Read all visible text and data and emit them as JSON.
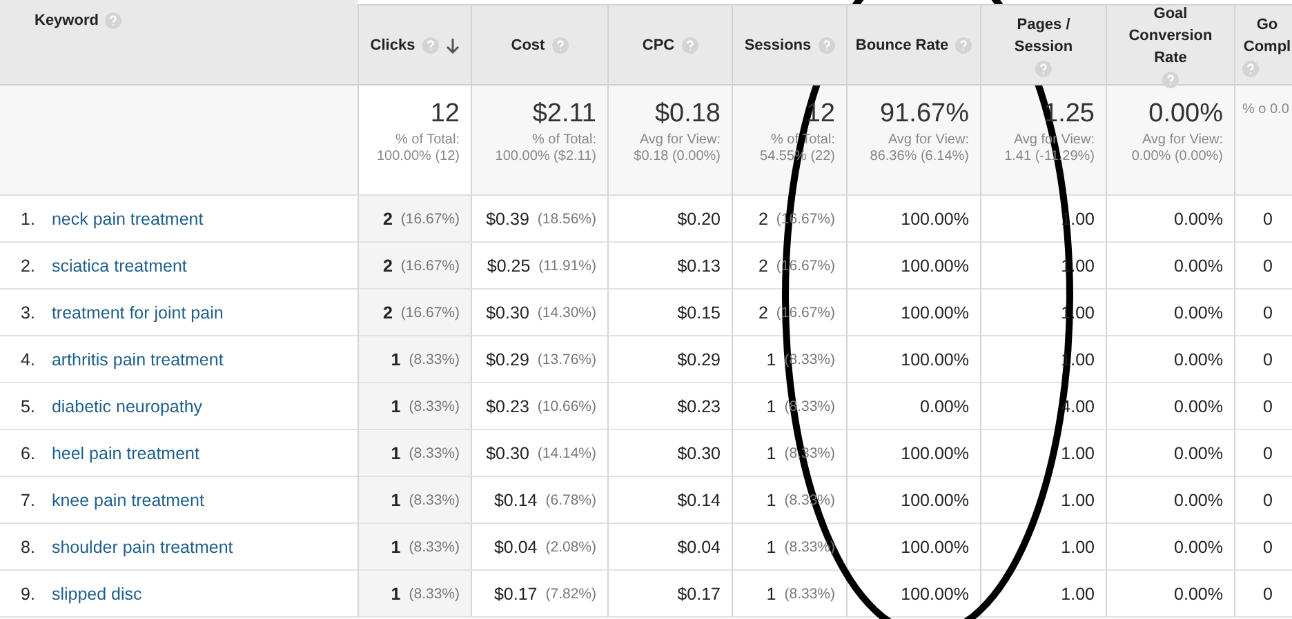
{
  "table": {
    "keyword_header": "Keyword",
    "columns": [
      {
        "label": "Clicks",
        "sorted": true
      },
      {
        "label": "Cost",
        "sorted": false
      },
      {
        "label": "CPC",
        "sorted": false
      },
      {
        "label": "Sessions",
        "sorted": false
      },
      {
        "label": "Bounce Rate",
        "sorted": false
      },
      {
        "label": "Pages / Session",
        "sorted": false
      },
      {
        "label": "Goal Conversion Rate",
        "sorted": false
      },
      {
        "label": "Go Compl",
        "sorted": false
      }
    ],
    "summary": [
      {
        "value": "12",
        "note": "% of Total: 100.00% (12)"
      },
      {
        "value": "$2.11",
        "note": "% of Total: 100.00% ($2.11)"
      },
      {
        "value": "$0.18",
        "note": "Avg for View: $0.18 (0.00%)"
      },
      {
        "value": "12",
        "note": "% of Total: 54.55% (22)"
      },
      {
        "value": "91.67%",
        "note": "Avg for View: 86.36% (6.14%)"
      },
      {
        "value": "1.25",
        "note": "Avg for View: 1.41 (-11.29%)"
      },
      {
        "value": "0.00%",
        "note": "Avg for View: 0.00% (0.00%)"
      },
      {
        "note": "% o 0.0"
      }
    ],
    "rows": [
      {
        "number": "1.",
        "keyword": "neck pain treatment",
        "cells": [
          {
            "value": "2",
            "share": "(16.67%)"
          },
          {
            "value": "$0.39",
            "share": "(18.56%)"
          },
          {
            "value": "$0.20"
          },
          {
            "value": "2",
            "share": "(16.67%)"
          },
          {
            "value": "100.00%"
          },
          {
            "value": "1.00"
          },
          {
            "value": "0.00%"
          },
          {
            "value": "0"
          }
        ]
      },
      {
        "number": "2.",
        "keyword": "sciatica treatment",
        "cells": [
          {
            "value": "2",
            "share": "(16.67%)"
          },
          {
            "value": "$0.25",
            "share": "(11.91%)"
          },
          {
            "value": "$0.13"
          },
          {
            "value": "2",
            "share": "(16.67%)"
          },
          {
            "value": "100.00%"
          },
          {
            "value": "1.00"
          },
          {
            "value": "0.00%"
          },
          {
            "value": "0"
          }
        ]
      },
      {
        "number": "3.",
        "keyword": "treatment for joint pain",
        "cells": [
          {
            "value": "2",
            "share": "(16.67%)"
          },
          {
            "value": "$0.30",
            "share": "(14.30%)"
          },
          {
            "value": "$0.15"
          },
          {
            "value": "2",
            "share": "(16.67%)"
          },
          {
            "value": "100.00%"
          },
          {
            "value": "1.00"
          },
          {
            "value": "0.00%"
          },
          {
            "value": "0"
          }
        ]
      },
      {
        "number": "4.",
        "keyword": "arthritis pain treatment",
        "cells": [
          {
            "value": "1",
            "share": "(8.33%)"
          },
          {
            "value": "$0.29",
            "share": "(13.76%)"
          },
          {
            "value": "$0.29"
          },
          {
            "value": "1",
            "share": "(8.33%)"
          },
          {
            "value": "100.00%"
          },
          {
            "value": "1.00"
          },
          {
            "value": "0.00%"
          },
          {
            "value": "0"
          }
        ]
      },
      {
        "number": "5.",
        "keyword": "diabetic neuropathy",
        "cells": [
          {
            "value": "1",
            "share": "(8.33%)"
          },
          {
            "value": "$0.23",
            "share": "(10.66%)"
          },
          {
            "value": "$0.23"
          },
          {
            "value": "1",
            "share": "(8.33%)"
          },
          {
            "value": "0.00%"
          },
          {
            "value": "4.00"
          },
          {
            "value": "0.00%"
          },
          {
            "value": "0"
          }
        ]
      },
      {
        "number": "6.",
        "keyword": "heel pain treatment",
        "cells": [
          {
            "value": "1",
            "share": "(8.33%)"
          },
          {
            "value": "$0.30",
            "share": "(14.14%)"
          },
          {
            "value": "$0.30"
          },
          {
            "value": "1",
            "share": "(8.33%)"
          },
          {
            "value": "100.00%"
          },
          {
            "value": "1.00"
          },
          {
            "value": "0.00%"
          },
          {
            "value": "0"
          }
        ]
      },
      {
        "number": "7.",
        "keyword": "knee pain treatment",
        "cells": [
          {
            "value": "1",
            "share": "(8.33%)"
          },
          {
            "value": "$0.14",
            "share": "(6.78%)"
          },
          {
            "value": "$0.14"
          },
          {
            "value": "1",
            "share": "(8.33%)"
          },
          {
            "value": "100.00%"
          },
          {
            "value": "1.00"
          },
          {
            "value": "0.00%"
          },
          {
            "value": "0"
          }
        ]
      },
      {
        "number": "8.",
        "keyword": "shoulder pain treatment",
        "cells": [
          {
            "value": "1",
            "share": "(8.33%)"
          },
          {
            "value": "$0.04",
            "share": "(2.08%)"
          },
          {
            "value": "$0.04"
          },
          {
            "value": "1",
            "share": "(8.33%)"
          },
          {
            "value": "100.00%"
          },
          {
            "value": "1.00"
          },
          {
            "value": "0.00%"
          },
          {
            "value": "0"
          }
        ]
      },
      {
        "number": "9.",
        "keyword": "slipped disc",
        "cells": [
          {
            "value": "1",
            "share": "(8.33%)"
          },
          {
            "value": "$0.17",
            "share": "(7.82%)"
          },
          {
            "value": "$0.17"
          },
          {
            "value": "1",
            "share": "(8.33%)"
          },
          {
            "value": "100.00%"
          },
          {
            "value": "1.00"
          },
          {
            "value": "0.00%"
          },
          {
            "value": "0"
          }
        ]
      }
    ]
  }
}
